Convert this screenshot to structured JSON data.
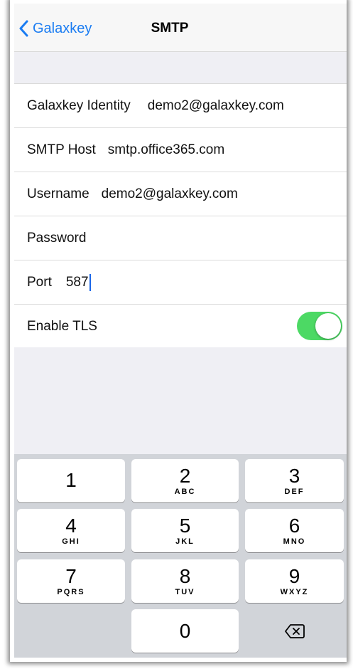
{
  "navbar": {
    "back_label": "Galaxkey",
    "title": "SMTP"
  },
  "settings": {
    "identity": {
      "label": "Galaxkey Identity",
      "value": "demo2@galaxkey.com"
    },
    "host": {
      "label": "SMTP Host",
      "value": "smtp.office365.com"
    },
    "username": {
      "label": "Username",
      "value": "demo2@galaxkey.com"
    },
    "password": {
      "label": "Password",
      "value": ""
    },
    "port": {
      "label": "Port",
      "value": "587"
    },
    "tls": {
      "label": "Enable TLS",
      "enabled": true
    }
  },
  "colors": {
    "accent": "#1a7cf2",
    "toggle_on": "#4cd964",
    "group_background": "#efeff4",
    "keyboard_background": "#d1d4d9"
  },
  "keypad": {
    "keys": [
      {
        "num": "1",
        "letters": ""
      },
      {
        "num": "2",
        "letters": "ABC"
      },
      {
        "num": "3",
        "letters": "DEF"
      },
      {
        "num": "4",
        "letters": "GHI"
      },
      {
        "num": "5",
        "letters": "JKL"
      },
      {
        "num": "6",
        "letters": "MNO"
      },
      {
        "num": "7",
        "letters": "PQRS"
      },
      {
        "num": "8",
        "letters": "TUV"
      },
      {
        "num": "9",
        "letters": "WXYZ"
      },
      {
        "num": "0",
        "letters": ""
      }
    ],
    "delete_icon": "backspace-icon"
  }
}
